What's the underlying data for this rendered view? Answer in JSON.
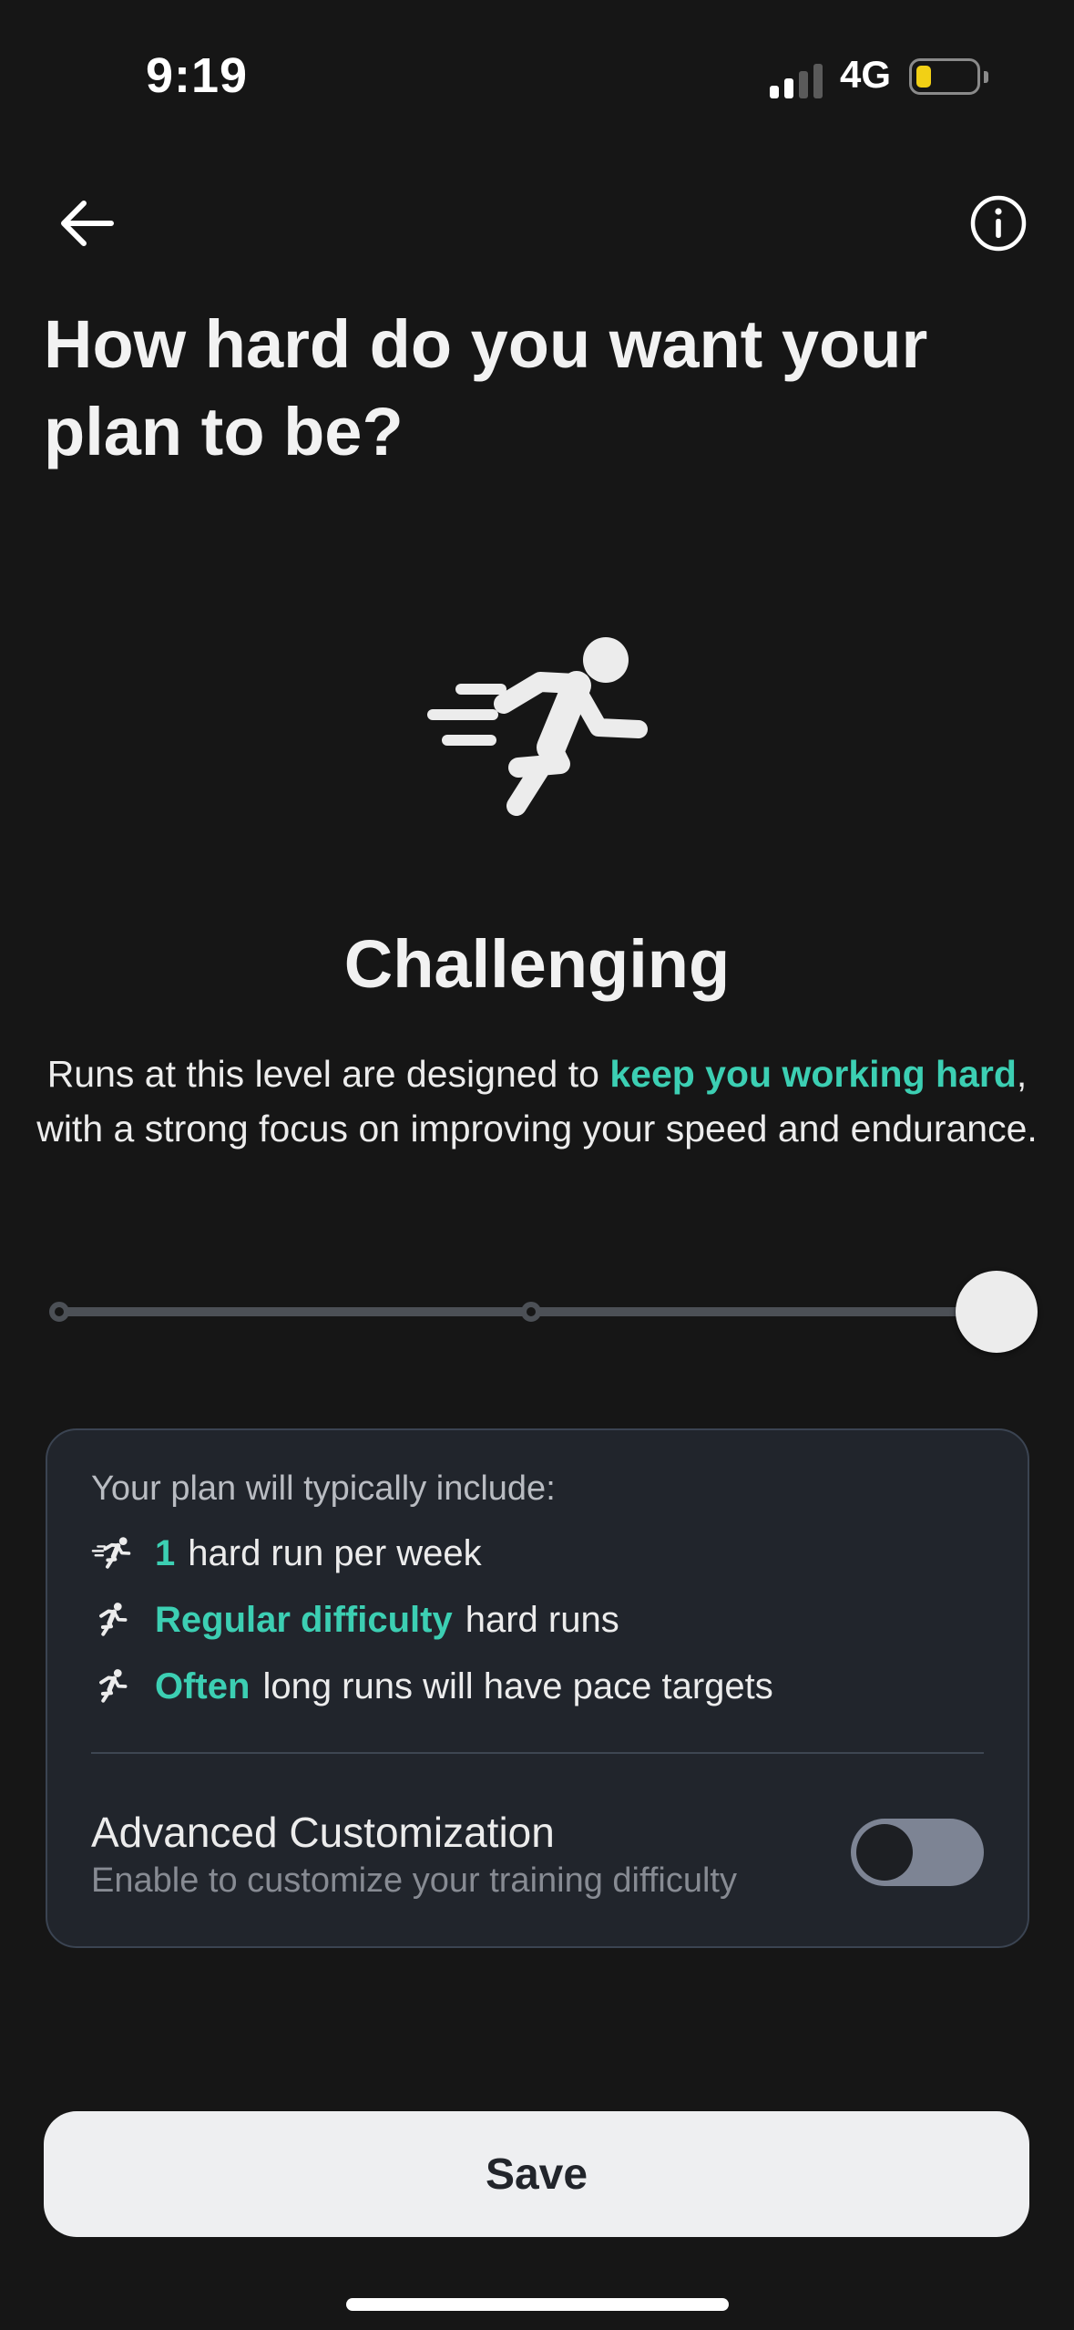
{
  "status_bar": {
    "time": "9:19",
    "network": "4G",
    "battery_color": "#f2d015"
  },
  "nav": {
    "back_icon": "arrow-left-icon",
    "info_icon": "info-circle-icon"
  },
  "title": "How hard do you want your plan to be?",
  "hero_icon": "runner-fast-icon",
  "level": {
    "name": "Challenging",
    "description_before": "Runs at this level are designed to ",
    "description_highlight": "keep you working hard",
    "description_after": ", with a strong focus on improving your speed and endurance."
  },
  "slider": {
    "stops": 3,
    "selected_index": 2
  },
  "summary": {
    "heading": "Your plan will typically include:",
    "items": [
      {
        "icon": "runner-fast-icon",
        "highlight": "1",
        "text": "hard run per week"
      },
      {
        "icon": "runner-icon",
        "highlight": "Regular difficulty",
        "text": "hard runs"
      },
      {
        "icon": "runner-icon",
        "highlight": "Often",
        "text": "long runs will have pace targets"
      }
    ],
    "advanced": {
      "title": "Advanced Customization",
      "subtitle": "Enable to customize your training difficulty",
      "enabled": false
    }
  },
  "save_label": "Save",
  "colors": {
    "accent": "#3ccfb3",
    "background": "#161616",
    "card": "#21252c"
  }
}
